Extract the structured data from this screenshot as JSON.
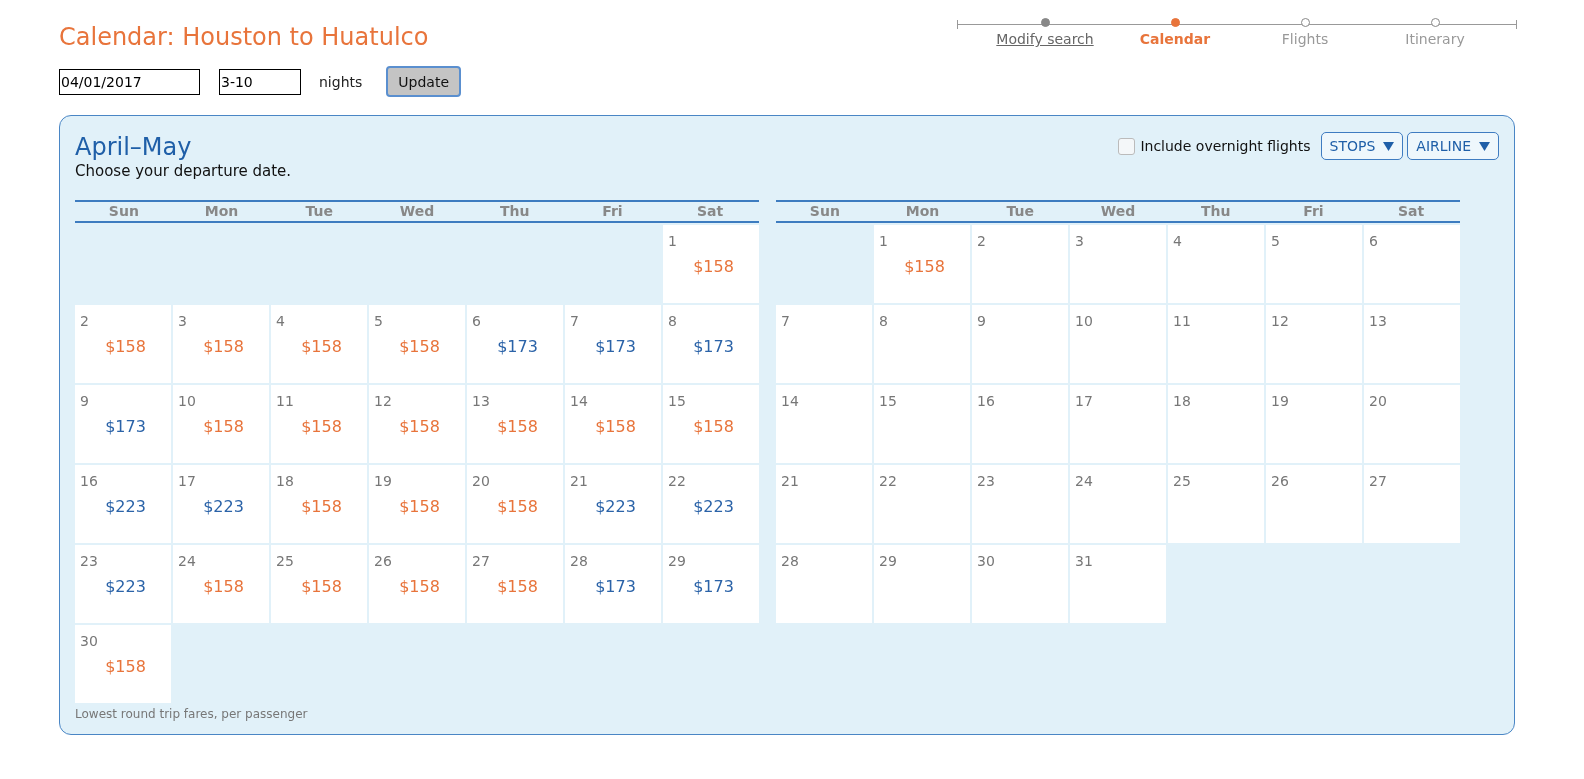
{
  "title": "Calendar: Houston to Huatulco",
  "steps": [
    {
      "label": "Modify search",
      "kind": "done"
    },
    {
      "label": "Calendar",
      "kind": "current"
    },
    {
      "label": "Flights",
      "kind": "upcoming"
    },
    {
      "label": "Itinerary",
      "kind": "upcoming"
    }
  ],
  "search": {
    "date": "04/01/2017",
    "nights_value": "3-10",
    "nights_label": "nights",
    "button": "Update"
  },
  "panel": {
    "heading": "April–May",
    "subheading": "Choose your departure date.",
    "overnight": {
      "label": "Include overnight flights",
      "checked": false
    },
    "filters": [
      "STOPS",
      "AIRLINE"
    ],
    "footnote": "Lowest round trip fares, per passenger",
    "months": [
      {
        "weekdays": [
          "Sun",
          "Mon",
          "Tue",
          "Wed",
          "Thu",
          "Fri",
          "Sat"
        ],
        "days": [
          {
            "kind": "blank"
          },
          {
            "kind": "blank"
          },
          {
            "kind": "blank"
          },
          {
            "kind": "blank"
          },
          {
            "kind": "blank"
          },
          {
            "kind": "blank"
          },
          {
            "day": "1",
            "price": "$158",
            "color": "#e8743b"
          },
          {
            "day": "2",
            "price": "$158",
            "color": "#e8743b"
          },
          {
            "day": "3",
            "price": "$158",
            "color": "#e8743b"
          },
          {
            "day": "4",
            "price": "$158",
            "color": "#e8743b"
          },
          {
            "day": "5",
            "price": "$158",
            "color": "#e8743b"
          },
          {
            "day": "6",
            "price": "$173",
            "color": "#2b63a8"
          },
          {
            "day": "7",
            "price": "$173",
            "color": "#2b63a8"
          },
          {
            "day": "8",
            "price": "$173",
            "color": "#2b63a8"
          },
          {
            "day": "9",
            "price": "$173",
            "color": "#2b63a8"
          },
          {
            "day": "10",
            "price": "$158",
            "color": "#e8743b"
          },
          {
            "day": "11",
            "price": "$158",
            "color": "#e8743b"
          },
          {
            "day": "12",
            "price": "$158",
            "color": "#e8743b"
          },
          {
            "day": "13",
            "price": "$158",
            "color": "#e8743b"
          },
          {
            "day": "14",
            "price": "$158",
            "color": "#e8743b"
          },
          {
            "day": "15",
            "price": "$158",
            "color": "#e8743b"
          },
          {
            "day": "16",
            "price": "$223",
            "color": "#2b63a8"
          },
          {
            "day": "17",
            "price": "$223",
            "color": "#2b63a8"
          },
          {
            "day": "18",
            "price": "$158",
            "color": "#e8743b"
          },
          {
            "day": "19",
            "price": "$158",
            "color": "#e8743b"
          },
          {
            "day": "20",
            "price": "$158",
            "color": "#e8743b"
          },
          {
            "day": "21",
            "price": "$223",
            "color": "#2b63a8"
          },
          {
            "day": "22",
            "price": "$223",
            "color": "#2b63a8"
          },
          {
            "day": "23",
            "price": "$223",
            "color": "#2b63a8"
          },
          {
            "day": "24",
            "price": "$158",
            "color": "#e8743b"
          },
          {
            "day": "25",
            "price": "$158",
            "color": "#e8743b"
          },
          {
            "day": "26",
            "price": "$158",
            "color": "#e8743b"
          },
          {
            "day": "27",
            "price": "$158",
            "color": "#e8743b"
          },
          {
            "day": "28",
            "price": "$173",
            "color": "#2b63a8"
          },
          {
            "day": "29",
            "price": "$173",
            "color": "#2b63a8"
          },
          {
            "day": "30",
            "price": "$158",
            "color": "#e8743b"
          }
        ]
      },
      {
        "weekdays": [
          "Sun",
          "Mon",
          "Tue",
          "Wed",
          "Thu",
          "Fri",
          "Sat"
        ],
        "days": [
          {
            "kind": "blank"
          },
          {
            "day": "1",
            "price": "$158",
            "color": "#e8743b"
          },
          {
            "day": "2"
          },
          {
            "day": "3"
          },
          {
            "day": "4"
          },
          {
            "day": "5"
          },
          {
            "day": "6"
          },
          {
            "day": "7"
          },
          {
            "day": "8"
          },
          {
            "day": "9"
          },
          {
            "day": "10"
          },
          {
            "day": "11"
          },
          {
            "day": "12"
          },
          {
            "day": "13"
          },
          {
            "day": "14"
          },
          {
            "day": "15"
          },
          {
            "day": "16"
          },
          {
            "day": "17"
          },
          {
            "day": "18"
          },
          {
            "day": "19"
          },
          {
            "day": "20"
          },
          {
            "day": "21"
          },
          {
            "day": "22"
          },
          {
            "day": "23"
          },
          {
            "day": "24"
          },
          {
            "day": "25"
          },
          {
            "day": "26"
          },
          {
            "day": "27"
          },
          {
            "day": "28"
          },
          {
            "day": "29"
          },
          {
            "day": "30"
          },
          {
            "day": "31"
          }
        ]
      }
    ]
  }
}
